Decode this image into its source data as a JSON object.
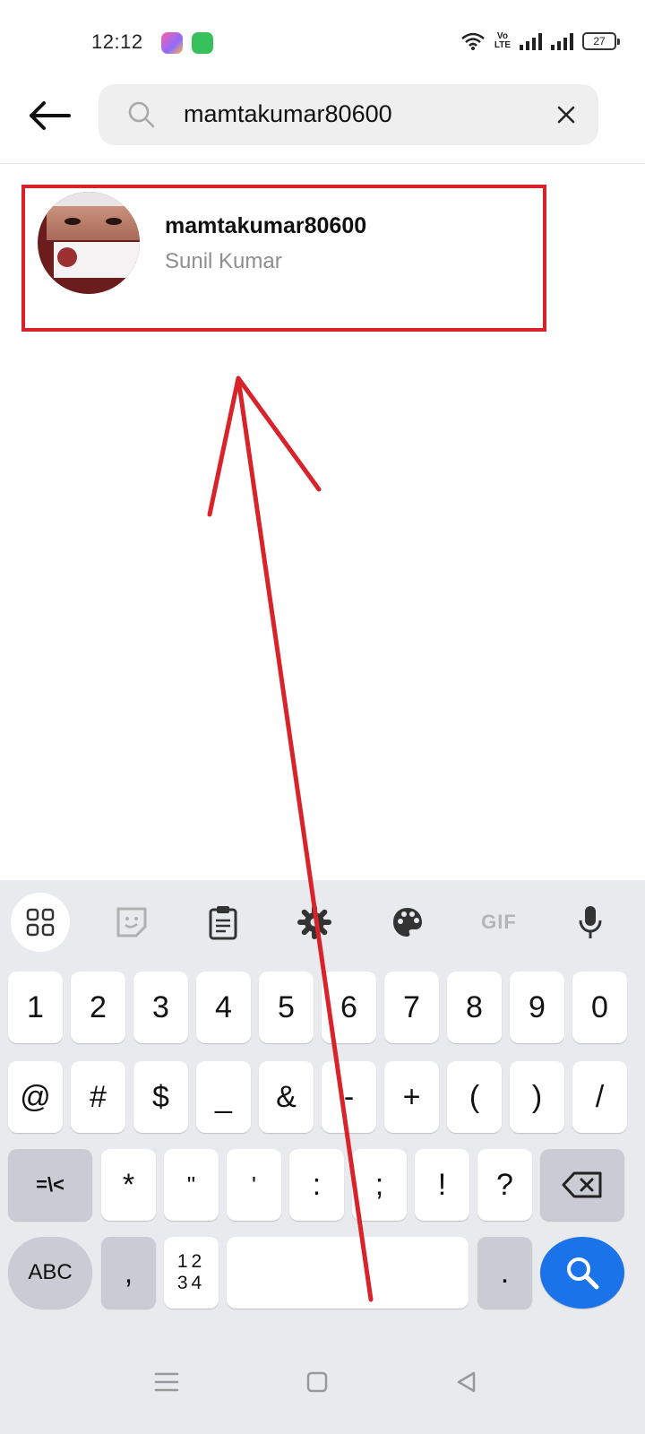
{
  "status_bar": {
    "time": "12:12",
    "network_label": "Vo\nLTE",
    "battery_level": "27"
  },
  "search": {
    "query": "mamtakumar80600",
    "icons": {
      "back": "back-arrow-icon",
      "search": "search-icon",
      "clear": "close-icon"
    }
  },
  "result": {
    "username": "mamtakumar80600",
    "full_name": "Sunil Kumar"
  },
  "keyboard": {
    "toolbar": [
      "apps-grid-icon",
      "sticker-icon",
      "clipboard-icon",
      "settings-gear-icon",
      "palette-icon",
      "gif-label",
      "microphone-icon"
    ],
    "gif_label": "GIF",
    "row1": [
      "1",
      "2",
      "3",
      "4",
      "5",
      "6",
      "7",
      "8",
      "9",
      "0"
    ],
    "row2": [
      "@",
      "#",
      "$",
      "_",
      "&",
      "-",
      "+",
      "(",
      ")",
      "/"
    ],
    "row3": [
      "=\\<",
      "*",
      "\"",
      "'",
      ":",
      ";",
      "!",
      "?"
    ],
    "row4": {
      "abc": "ABC",
      "comma": ",",
      "numpad_top": "12",
      "numpad_bottom": "34",
      "period": "."
    }
  },
  "colors": {
    "annotation_red": "#d9232b",
    "search_key_blue": "#1a73e8",
    "keyboard_bg": "#e9eaee"
  }
}
